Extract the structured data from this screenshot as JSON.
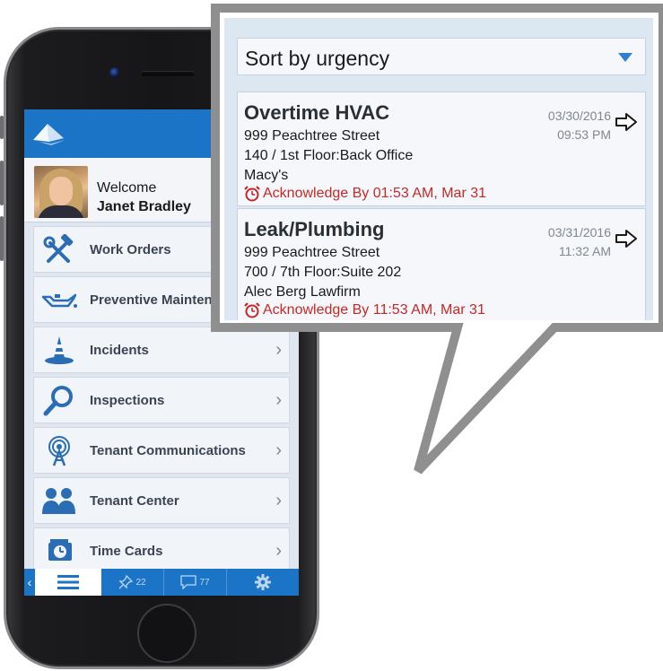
{
  "app": {
    "header_logo": "pyramid-logo-icon"
  },
  "welcome": {
    "greeting": "Welcome",
    "user_name": "Janet Bradley"
  },
  "menu": {
    "items": [
      {
        "label": "Work Orders",
        "icon": "wrench-hammer-icon"
      },
      {
        "label": "Preventive Maintenance",
        "icon": "oil-can-icon"
      },
      {
        "label": "Incidents",
        "icon": "traffic-cone-icon"
      },
      {
        "label": "Inspections",
        "icon": "magnifier-icon"
      },
      {
        "label": "Tenant Communications",
        "icon": "broadcast-tower-icon"
      },
      {
        "label": "Tenant Center",
        "icon": "people-icon"
      },
      {
        "label": "Time Cards",
        "icon": "clock-card-icon"
      }
    ],
    "chevron": "›"
  },
  "tabbar": {
    "back": "‹",
    "pins_count": "22",
    "messages_count": "77"
  },
  "popup": {
    "sort": {
      "label": "Sort by urgency"
    },
    "work_orders": [
      {
        "title": "Overtime HVAC",
        "address": "999 Peachtree Street",
        "location": "140 / 1st Floor:Back Office",
        "tenant": "Macy's",
        "acknowledge": "Acknowledge By 01:53 AM, Mar 31",
        "date": "03/30/2016",
        "time": "09:53 PM"
      },
      {
        "title": "Leak/Plumbing",
        "address": "999 Peachtree Street",
        "location": "700 / 7th Floor:Suite 202",
        "tenant": "Alec Berg Lawfirm",
        "acknowledge": "Acknowledge By 11:53 AM, Mar 31",
        "date": "03/31/2016",
        "time": "11:32 AM"
      }
    ]
  },
  "colors": {
    "brand_blue": "#1c74c7",
    "alert_red": "#c62828",
    "bubble_border": "#8f8f8f"
  }
}
